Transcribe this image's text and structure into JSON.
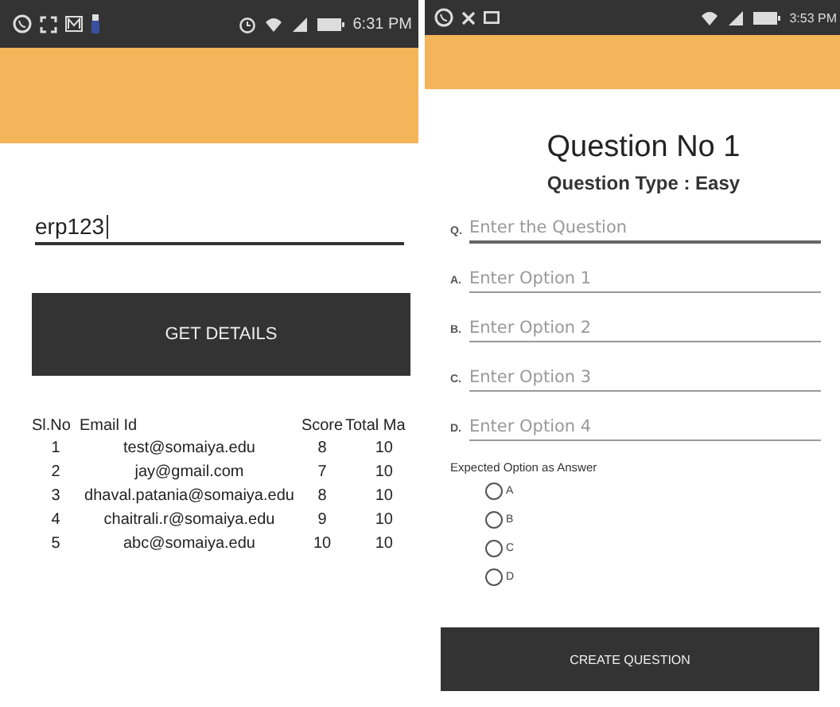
{
  "left_screen": {
    "status_bar": {
      "time": "6:31 PM"
    },
    "erp_field": {
      "value": "erp123"
    },
    "button": "GET DETAILS",
    "table": {
      "columns": [
        "Sl.No",
        "Email Id",
        "Score",
        "Total Ma"
      ],
      "rows": [
        [
          "1",
          "test@somaiya.edu",
          "8",
          "10"
        ],
        [
          "2",
          "jay@gmail.com",
          "7",
          "10"
        ],
        [
          "3",
          "dhaval.patania@somaiya.edu",
          "8",
          "10"
        ],
        [
          "4",
          "chaitrali.r@somaiya.edu",
          "9",
          "10"
        ],
        [
          "5",
          "abc@somaiya.edu",
          "10",
          "10"
        ]
      ]
    }
  },
  "right_screen": {
    "status_bar": {
      "time": "3:53 PM"
    },
    "title": "Question No 1",
    "subtitle": "Question Type : Easy",
    "fields": [
      {
        "label": "Q.",
        "placeholder": "Enter the Question",
        "focused": true
      },
      {
        "label": "A.",
        "placeholder": "Enter Option 1",
        "focused": false
      },
      {
        "label": "B.",
        "placeholder": "Enter Option 2",
        "focused": false
      },
      {
        "label": "C.",
        "placeholder": "Enter Option 3",
        "focused": false
      },
      {
        "label": "D.",
        "placeholder": "Enter Option 4",
        "focused": false
      }
    ],
    "answer_label": "Expected Option as Answer",
    "options": [
      {
        "label": "A",
        "selected": false
      },
      {
        "label": "B",
        "selected": false
      },
      {
        "label": "C",
        "selected": false
      },
      {
        "label": "D",
        "selected": false
      }
    ],
    "button": "CREATE QUESTION"
  }
}
